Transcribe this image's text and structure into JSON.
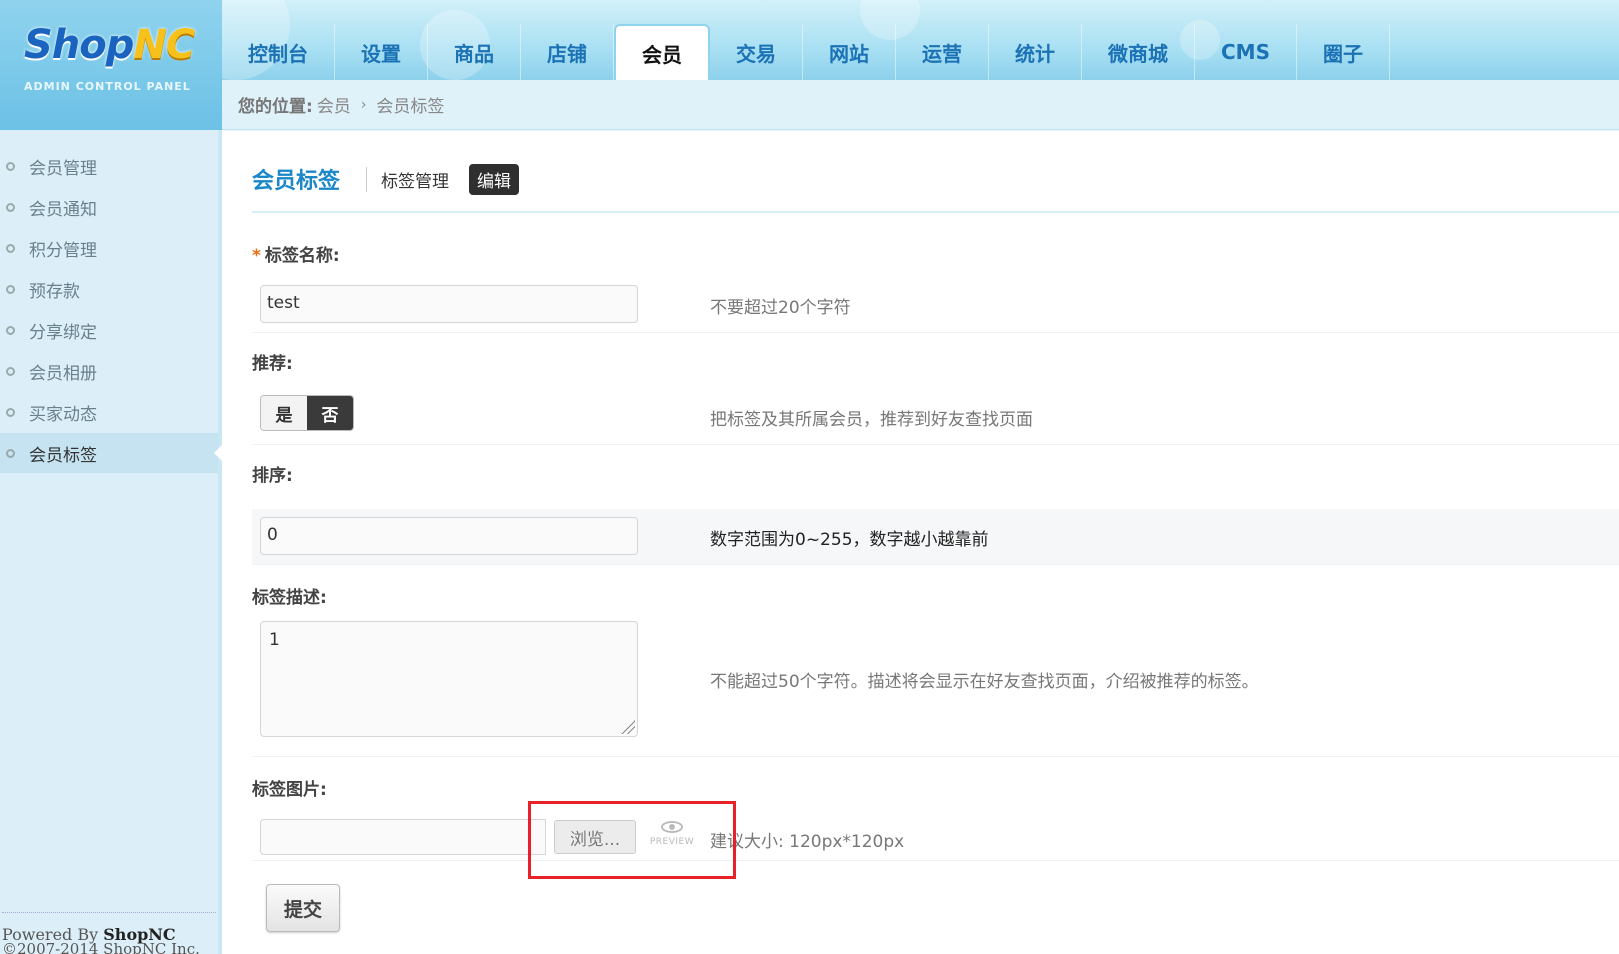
{
  "logo": {
    "part1": "Shop",
    "part2": "NC",
    "subtitle": "ADMIN CONTROL PANEL"
  },
  "nav": {
    "items": [
      {
        "label": "控制台"
      },
      {
        "label": "设置"
      },
      {
        "label": "商品"
      },
      {
        "label": "店铺"
      },
      {
        "label": "会员"
      },
      {
        "label": "交易"
      },
      {
        "label": "网站"
      },
      {
        "label": "运营"
      },
      {
        "label": "统计"
      },
      {
        "label": "微商城"
      },
      {
        "label": "CMS"
      },
      {
        "label": "圈子"
      }
    ],
    "active": "会员"
  },
  "breadcrumb": {
    "prefix": "您的位置:",
    "level1": "会员",
    "separator": "›",
    "level2": "会员标签"
  },
  "sidebar": {
    "items": [
      {
        "label": "会员管理"
      },
      {
        "label": "会员通知"
      },
      {
        "label": "积分管理"
      },
      {
        "label": "预存款"
      },
      {
        "label": "分享绑定"
      },
      {
        "label": "会员相册"
      },
      {
        "label": "买家动态"
      },
      {
        "label": "会员标签"
      }
    ],
    "active": "会员标签",
    "powered_prefix": "Powered By ",
    "powered_brand": "ShopNC",
    "copyright": "©2007-2014 ShopNC Inc."
  },
  "page": {
    "title": "会员标签",
    "tab_manage": "标签管理",
    "tab_edit": "编辑"
  },
  "form": {
    "name": {
      "required_mark": "*",
      "label": "标签名称:",
      "value": "test",
      "hint": "不要超过20个字符"
    },
    "recommend": {
      "label": "推荐:",
      "yes": "是",
      "no": "否",
      "selected": "否",
      "hint": "把标签及其所属会员，推荐到好友查找页面"
    },
    "sort": {
      "label": "排序:",
      "value": "0",
      "hint": "数字范围为0~255，数字越小越靠前"
    },
    "desc": {
      "label": "标签描述:",
      "value": "1",
      "hint": "不能超过50个字符。描述将会显示在好友查找页面，介绍被推荐的标签。"
    },
    "image": {
      "label": "标签图片:",
      "value": "",
      "browse": "浏览...",
      "preview": "PREVIEW",
      "hint": "建议大小: 120px*120px"
    },
    "submit": "提交"
  },
  "colors": {
    "accent": "#1a87c9",
    "required": "#f26b0f",
    "highlight_box": "#e8202a",
    "nav_text": "#1b72b5"
  },
  "icons": {
    "sidebar_bullet": "circle-bullet-icon",
    "preview": "eye-icon",
    "resize": "resize-handle-icon"
  }
}
